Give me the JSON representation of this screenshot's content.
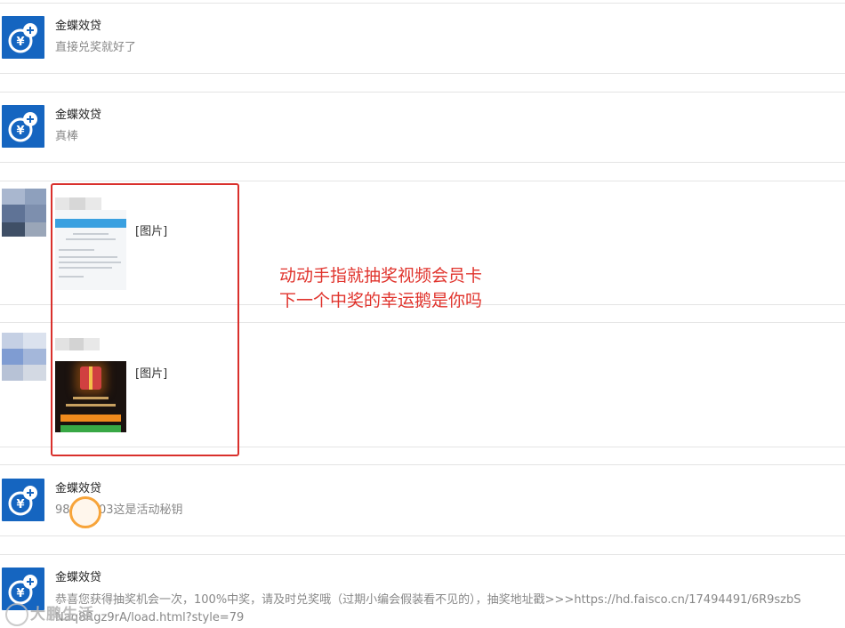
{
  "colors": {
    "avatar_bg": "#1565c0",
    "annotation_red": "#e0332c",
    "box_red": "#d9302c",
    "message_gray": "#888888"
  },
  "messages": [
    {
      "sender": "金蝶效贷",
      "avatar_icon": "yen-coin-plus-icon",
      "text": "直接兑奖就好了"
    },
    {
      "sender": "金蝶效贷",
      "avatar_icon": "yen-coin-plus-icon",
      "text": "真棒"
    },
    {
      "sender": "",
      "avatar_icon": "blurred-user-avatar",
      "text": "[图片]"
    },
    {
      "sender": "",
      "avatar_icon": "blurred-user-avatar",
      "text": "[图片]"
    },
    {
      "sender": "金蝶效贷",
      "avatar_icon": "yen-coin-plus-icon",
      "text_visible_prefix": "98",
      "text_visible_suffix": "03这是活动秘钥"
    },
    {
      "sender": "金蝶效贷",
      "avatar_icon": "yen-coin-plus-icon",
      "text_line1": "恭喜您获得抽奖机会一次，100%中奖，请及时兑奖哦（过期小编会假装看不见的），抽奖地址戳>>>https://hd.faisco.cn/17494491/6R9szbS",
      "text_line2": "Naq8Rgz9rA/load.html?style=79"
    }
  ],
  "annotation": {
    "line1": "动动手指就抽奖视频会员卡",
    "line2": "下一个中奖的幸运鹅是你吗"
  },
  "watermark": {
    "text": "大鹏生活"
  }
}
